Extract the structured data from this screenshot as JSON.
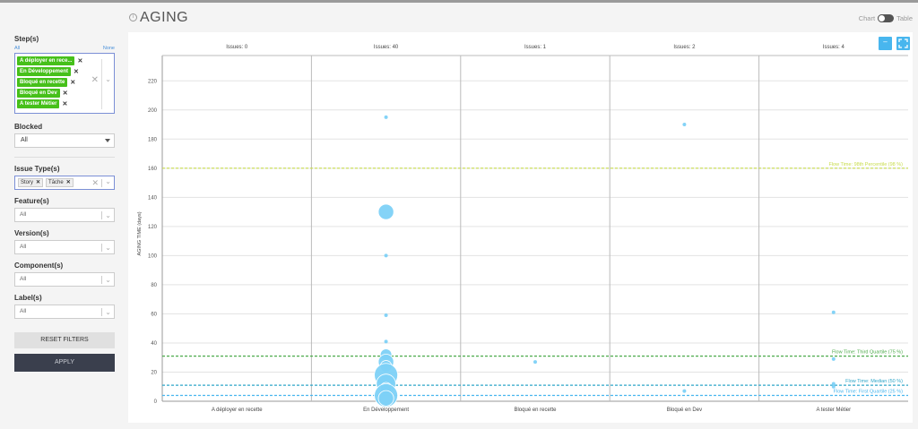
{
  "sidebar": {
    "steps_label": "Step(s)",
    "all_link": "All",
    "none_link": "None",
    "steps": [
      "A déployer en rece...",
      "En Développement",
      "Bloqué en recette",
      "Bloqué en Dev",
      "A tester Métier"
    ],
    "blocked_label": "Blocked",
    "blocked_value": "All",
    "issue_type_label": "Issue Type(s)",
    "issue_types": [
      "Story",
      "Tâche"
    ],
    "feature_label": "Feature(s)",
    "feature_value": "All",
    "version_label": "Version(s)",
    "version_value": "All",
    "component_label": "Component(s)",
    "component_value": "All",
    "label_label": "Label(s)",
    "label_value": "All",
    "reset_label": "RESET FILTERS",
    "apply_label": "APPLY"
  },
  "header": {
    "title": "AGING",
    "chart_label": "Chart",
    "table_label": "Table"
  },
  "toolbar": {
    "minus_label": "–"
  },
  "chart_data": {
    "type": "scatter",
    "ylabel": "AGING TIME (days)",
    "ylim": [
      0,
      230
    ],
    "yticks": [
      0,
      20,
      40,
      60,
      80,
      100,
      120,
      140,
      160,
      180,
      200,
      220
    ],
    "columns": [
      {
        "name": "A déployer en recette",
        "issues_label": "Issues: 0"
      },
      {
        "name": "En Développement",
        "issues_label": "Issues: 40"
      },
      {
        "name": "Bloqué en recette",
        "issues_label": "Issues: 1"
      },
      {
        "name": "Bloqué en Dev",
        "issues_label": "Issues: 2"
      },
      {
        "name": "A tester Métier",
        "issues_label": "Issues: 4"
      }
    ],
    "points": [
      {
        "col": 1,
        "y": 195,
        "size": 1
      },
      {
        "col": 1,
        "y": 130,
        "size": 4
      },
      {
        "col": 1,
        "y": 100,
        "size": 1
      },
      {
        "col": 1,
        "y": 59,
        "size": 1
      },
      {
        "col": 1,
        "y": 41,
        "size": 1
      },
      {
        "col": 1,
        "y": 32,
        "size": 3
      },
      {
        "col": 1,
        "y": 27,
        "size": 4
      },
      {
        "col": 1,
        "y": 24,
        "size": 3
      },
      {
        "col": 1,
        "y": 18,
        "size": 6
      },
      {
        "col": 1,
        "y": 12,
        "size": 5
      },
      {
        "col": 1,
        "y": 9,
        "size": 3
      },
      {
        "col": 1,
        "y": 4,
        "size": 6
      },
      {
        "col": 1,
        "y": 2,
        "size": 4
      },
      {
        "col": 2,
        "y": 27,
        "size": 1
      },
      {
        "col": 3,
        "y": 190,
        "size": 1
      },
      {
        "col": 3,
        "y": 7,
        "size": 1
      },
      {
        "col": 4,
        "y": 61,
        "size": 1
      },
      {
        "col": 4,
        "y": 29,
        "size": 1
      },
      {
        "col": 4,
        "y": 12,
        "size": 1
      },
      {
        "col": 4,
        "y": 10,
        "size": 1
      }
    ],
    "reference_lines": [
      {
        "label": "Flow Time: 98th Percentile (98 %)",
        "y": 160,
        "color": "#c8dc4a"
      },
      {
        "label": "Flow Time: Third Quartile (75 %)",
        "y": 31,
        "color": "#4caa4a"
      },
      {
        "label": "Flow Time: Median (50 %)",
        "y": 11,
        "color": "#2ea5c8"
      },
      {
        "label": "Flow Time: First Quartile (25 %)",
        "y": 4,
        "color": "#48b6ee"
      }
    ],
    "point_color": "#7dd1f7",
    "grid": true
  }
}
